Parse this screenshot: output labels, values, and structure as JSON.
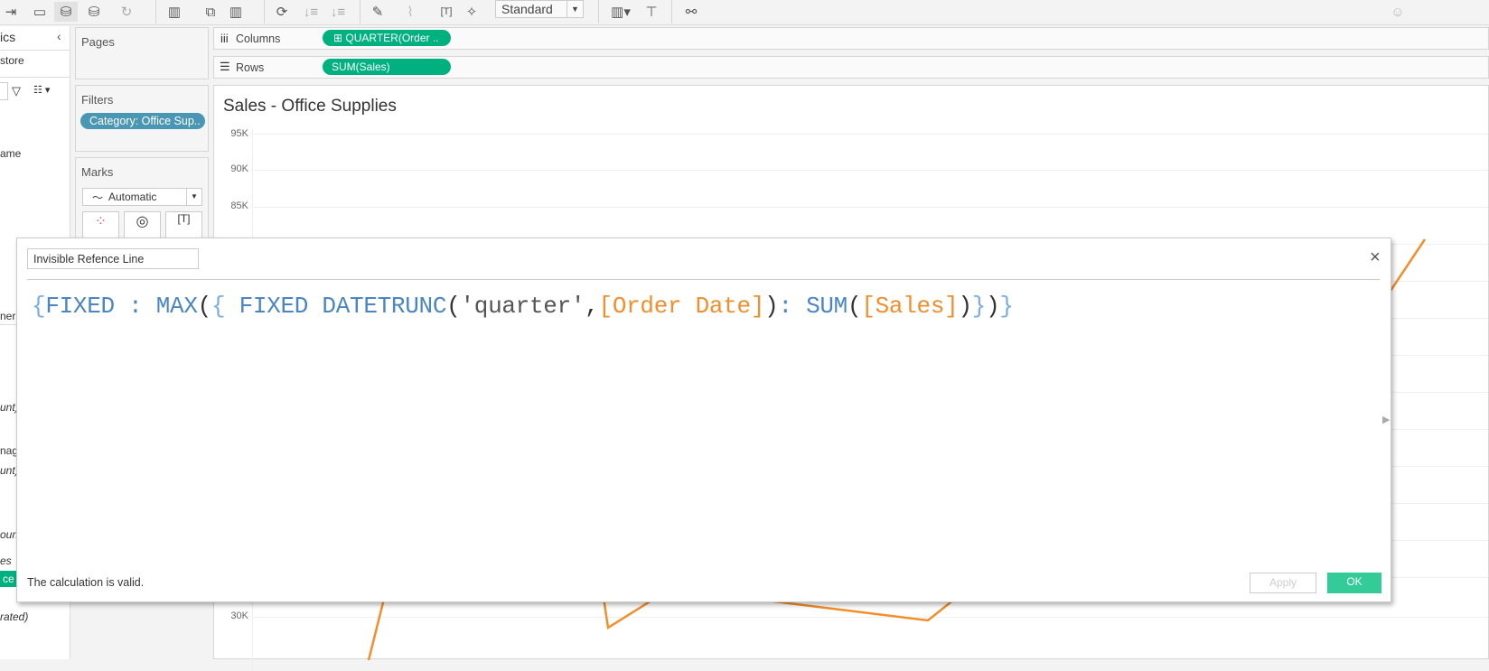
{
  "toolbar": {
    "view_size": "Standard",
    "icons": [
      "swap-icon",
      "save-icon",
      "new-datasource-icon",
      "pause-updates-icon",
      "refresh-icon",
      "new-worksheet-icon",
      "duplicate-sheet-icon",
      "clear-sheet-icon",
      "swap-rows-columns-icon",
      "sort-ascending-icon",
      "sort-descending-icon",
      "highlight-icon",
      "group-icon",
      "show-labels-icon",
      "pin-icon",
      "show-me-icon",
      "presentation-icon",
      "share-icon",
      "user-icon"
    ]
  },
  "data_pane": {
    "header": "ics",
    "datasource": "store",
    "fields": [
      "ame",
      "ners",
      "unt)",
      "nag",
      "unt)",
      "ount",
      "es",
      "ce",
      "rated)"
    ]
  },
  "shelves": {
    "pages": "Pages",
    "filters": "Filters",
    "filter_pill": "Category: Office Sup..",
    "marks": "Marks",
    "mark_type": "Automatic",
    "columns_label": "Columns",
    "columns_pill": "QUARTER(Order ..",
    "rows_label": "Rows",
    "rows_pill": "SUM(Sales)"
  },
  "view": {
    "title": "Sales - Office Supplies",
    "y_ticks": [
      "95K",
      "90K",
      "85K",
      "30K"
    ]
  },
  "dialog": {
    "name": "Invisible Refence Line",
    "code": [
      {
        "t": "{",
        "c": "brace"
      },
      {
        "t": "FIXED",
        "c": "kw"
      },
      {
        "t": " : ",
        "c": "kw"
      },
      {
        "t": "MAX",
        "c": "kw"
      },
      {
        "t": "(",
        "c": "paren"
      },
      {
        "t": "{",
        "c": "brace"
      },
      {
        "t": " FIXED ",
        "c": "kw"
      },
      {
        "t": "DATETRUNC",
        "c": "kw"
      },
      {
        "t": "(",
        "c": "paren"
      },
      {
        "t": "'quarter'",
        "c": "str"
      },
      {
        "t": ",",
        "c": "paren"
      },
      {
        "t": "[Order Date]",
        "c": "field"
      },
      {
        "t": ")",
        "c": "paren"
      },
      {
        "t": ": ",
        "c": "kw"
      },
      {
        "t": "SUM",
        "c": "kw"
      },
      {
        "t": "(",
        "c": "paren"
      },
      {
        "t": "[Sales]",
        "c": "field"
      },
      {
        "t": ")",
        "c": "paren"
      },
      {
        "t": "}",
        "c": "brace"
      },
      {
        "t": ")",
        "c": "paren"
      },
      {
        "t": "}",
        "c": "brace"
      }
    ],
    "status": "The calculation is valid.",
    "apply": "Apply",
    "ok": "OK"
  },
  "colors": {
    "green_pill": "#00b180",
    "filter_pill": "#4a96b5",
    "line": "#f28e2b",
    "keyword": "#4a86c5",
    "field": "#f28e2b",
    "ok": "#33cc99"
  }
}
